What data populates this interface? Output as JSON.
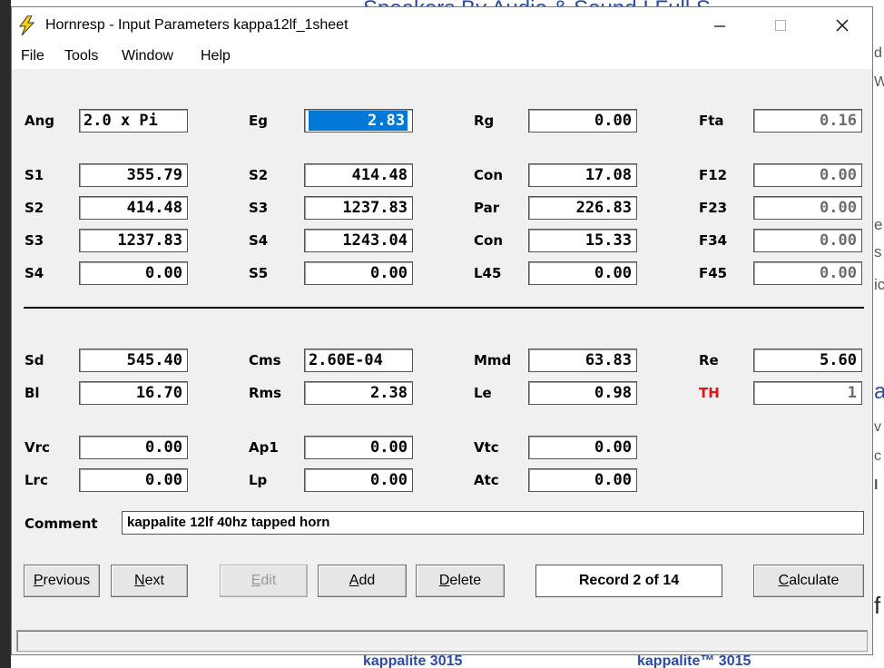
{
  "window": {
    "title": "Hornresp - Input Parameters   kappa12lf_1sheet",
    "controls": {
      "minimize": "—",
      "maximize": "☐",
      "close": "✕"
    }
  },
  "menu": [
    "File",
    "Tools",
    "Window",
    "Help"
  ],
  "rows": {
    "r0": [
      {
        "label": "Ang",
        "value": "2.0 x Pi",
        "align": "left"
      },
      {
        "label": "Eg",
        "value": "2.83",
        "selected": true
      },
      {
        "label": "Rg",
        "value": "0.00"
      },
      {
        "label": "Fta",
        "value": "0.16",
        "readonly": true
      }
    ],
    "r1": [
      {
        "label": "S1",
        "value": "355.79"
      },
      {
        "label": "S2",
        "value": "414.48"
      },
      {
        "label": "Con",
        "value": "17.08"
      },
      {
        "label": "F12",
        "value": "0.00",
        "readonly": true
      }
    ],
    "r2": [
      {
        "label": "S2",
        "value": "414.48"
      },
      {
        "label": "S3",
        "value": "1237.83"
      },
      {
        "label": "Par",
        "value": "226.83"
      },
      {
        "label": "F23",
        "value": "0.00",
        "readonly": true
      }
    ],
    "r3": [
      {
        "label": "S3",
        "value": "1237.83"
      },
      {
        "label": "S4",
        "value": "1243.04"
      },
      {
        "label": "Con",
        "value": "15.33"
      },
      {
        "label": "F34",
        "value": "0.00",
        "readonly": true
      }
    ],
    "r4": [
      {
        "label": "S4",
        "value": "0.00"
      },
      {
        "label": "S5",
        "value": "0.00"
      },
      {
        "label": "L45",
        "value": "0.00"
      },
      {
        "label": "F45",
        "value": "0.00",
        "readonly": true
      }
    ],
    "r5": [
      {
        "label": "Sd",
        "value": "545.40"
      },
      {
        "label": "Cms",
        "value": "2.60E-04",
        "align": "left"
      },
      {
        "label": "Mmd",
        "value": "63.83"
      },
      {
        "label": "Re",
        "value": "5.60"
      }
    ],
    "r6": [
      {
        "label": "Bl",
        "value": "16.70"
      },
      {
        "label": "Rms",
        "value": "2.38"
      },
      {
        "label": "Le",
        "value": "0.98"
      },
      {
        "label": "TH",
        "value": "1",
        "readonly": true,
        "red": true
      }
    ],
    "r7": [
      {
        "label": "Vrc",
        "value": "0.00"
      },
      {
        "label": "Ap1",
        "value": "0.00"
      },
      {
        "label": "Vtc",
        "value": "0.00"
      }
    ],
    "r8": [
      {
        "label": "Lrc",
        "value": "0.00"
      },
      {
        "label": "Lp",
        "value": "0.00"
      },
      {
        "label": "Atc",
        "value": "0.00"
      }
    ]
  },
  "comment": {
    "label": "Comment",
    "value": "kappalite 12lf 40hz tapped horn"
  },
  "buttons": {
    "previous": {
      "label": "Previous",
      "hotkey": "P"
    },
    "next": {
      "label": "Next",
      "hotkey": "N"
    },
    "edit": {
      "label": "Edit",
      "hotkey": "E"
    },
    "add": {
      "label": "Add",
      "hotkey": "A"
    },
    "delete": {
      "label": "Delete",
      "hotkey": "D"
    },
    "calculate": {
      "label": "Calculate",
      "hotkey": "C"
    }
  },
  "record": "Record 2 of 14",
  "background_page": {
    "heading": "Speakers By Audio & Sound I Full S",
    "links": [
      "kappalite 3015",
      "kappalite™ 3015"
    ]
  },
  "colors": {
    "selection": "#0078d7",
    "th_label": "#e01515",
    "link": "#2a4aa5"
  }
}
